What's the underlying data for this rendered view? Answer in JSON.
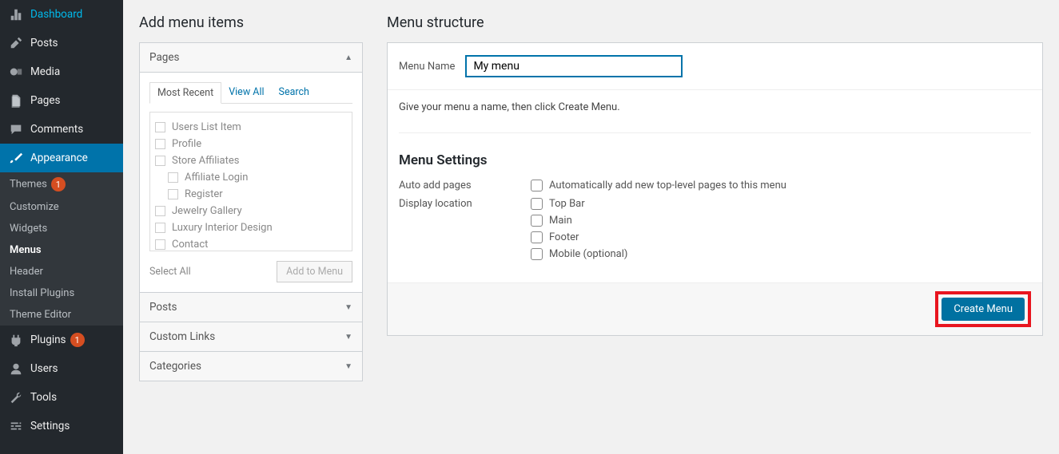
{
  "sidebar": {
    "items": [
      {
        "icon": "dashboard",
        "label": "Dashboard"
      },
      {
        "icon": "pin",
        "label": "Posts"
      },
      {
        "icon": "media",
        "label": "Media"
      },
      {
        "icon": "page",
        "label": "Pages"
      },
      {
        "icon": "comment",
        "label": "Comments"
      },
      {
        "icon": "brush",
        "label": "Appearance",
        "active": true
      },
      {
        "icon": "plugin",
        "label": "Plugins",
        "badge": "1"
      },
      {
        "icon": "user",
        "label": "Users"
      },
      {
        "icon": "wrench",
        "label": "Tools"
      },
      {
        "icon": "sliders",
        "label": "Settings"
      }
    ],
    "submenu": [
      {
        "label": "Themes",
        "badge": "1"
      },
      {
        "label": "Customize"
      },
      {
        "label": "Widgets"
      },
      {
        "label": "Menus",
        "current": true
      },
      {
        "label": "Header"
      },
      {
        "label": "Install Plugins"
      },
      {
        "label": "Theme Editor"
      }
    ]
  },
  "left": {
    "title": "Add menu items",
    "pages_label": "Pages",
    "tabs": [
      "Most Recent",
      "View All",
      "Search"
    ],
    "page_items": [
      {
        "label": "Users List Item",
        "indent": false
      },
      {
        "label": "Profile",
        "indent": false
      },
      {
        "label": "Store Affiliates",
        "indent": false
      },
      {
        "label": "Affiliate Login",
        "indent": true
      },
      {
        "label": "Register",
        "indent": true
      },
      {
        "label": "Jewelry Gallery",
        "indent": false
      },
      {
        "label": "Luxury Interior Design",
        "indent": false
      },
      {
        "label": "Contact",
        "indent": false
      }
    ],
    "select_all": "Select All",
    "add_btn": "Add to Menu",
    "collapsed": [
      "Posts",
      "Custom Links",
      "Categories"
    ]
  },
  "right": {
    "title": "Menu structure",
    "name_label": "Menu Name",
    "name_value": "My menu",
    "instruction": "Give your menu a name, then click Create Menu.",
    "settings_title": "Menu Settings",
    "auto_label": "Auto add pages",
    "auto_option": "Automatically add new top-level pages to this menu",
    "display_label": "Display location",
    "display_options": [
      "Top Bar",
      "Main",
      "Footer",
      "Mobile (optional)"
    ],
    "create_btn": "Create Menu"
  }
}
